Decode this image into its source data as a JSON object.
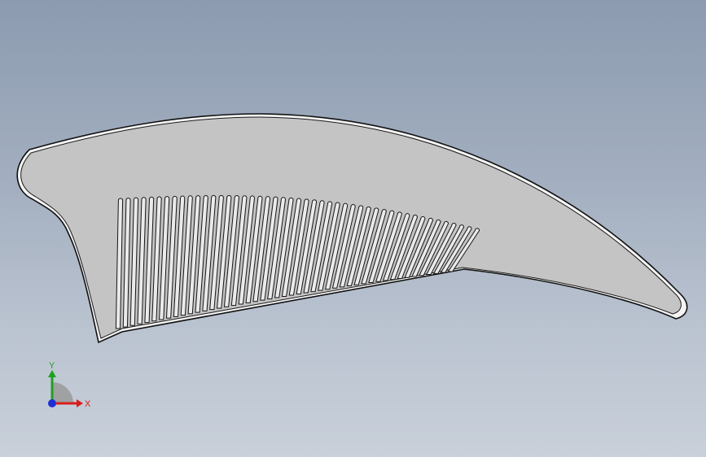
{
  "viewport": {
    "background_top": "#8c9bb0",
    "background_bottom": "#c9d0da",
    "part_fill": "#c4c4c4",
    "part_edge": "#1c1c1c"
  },
  "part": {
    "name": "comb",
    "teeth_count": 47
  },
  "triad": {
    "x_label": "X",
    "y_label": "Y",
    "x_color": "#d81e1e",
    "y_color": "#1fa11f",
    "z_color": "#1f2fd6"
  }
}
